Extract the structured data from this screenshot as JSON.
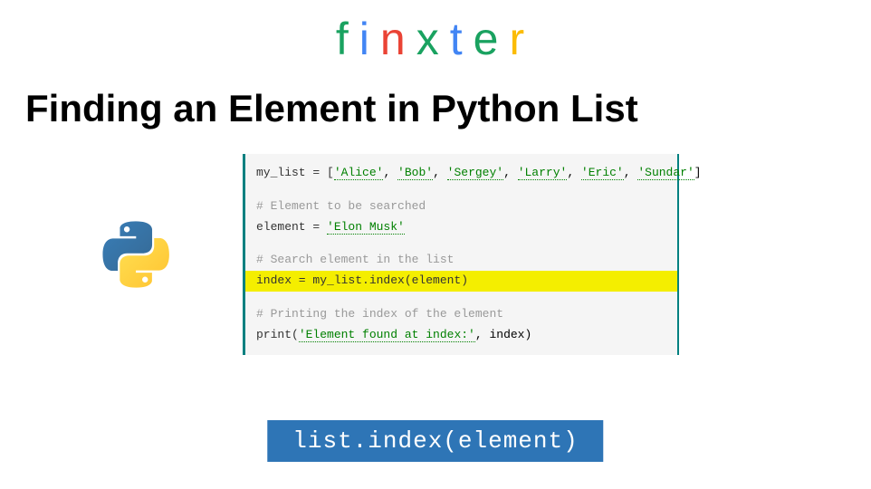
{
  "logo": {
    "letters": [
      {
        "char": "f",
        "color": "#1aa260"
      },
      {
        "char": "i",
        "color": "#4285f4"
      },
      {
        "char": "n",
        "color": "#ea4335"
      },
      {
        "char": "x",
        "color": "#1aa260"
      },
      {
        "char": "t",
        "color": "#4285f4"
      },
      {
        "char": "e",
        "color": "#1aa260"
      },
      {
        "char": "r",
        "color": "#fbbc05"
      }
    ]
  },
  "title": "Finding an Element in Python List",
  "code": {
    "line1_prefix": "my_list = [",
    "line1_strings": [
      "'Alice'",
      "'Bob'",
      "'Sergey'",
      "'Larry'",
      "'Eric'",
      "'Sundar'"
    ],
    "line1_suffix": "]",
    "comment1": "# Element to be searched",
    "line2_prefix": "element = ",
    "line2_string": "'Elon Musk'",
    "comment2": "# Search element in the list",
    "line3": "index = my_list.index(element)",
    "comment3": "# Printing the index of the element",
    "line4_prefix": "print(",
    "line4_string": "'Element found at index:'",
    "line4_suffix": ", index)"
  },
  "method_box": "list.index(element)"
}
